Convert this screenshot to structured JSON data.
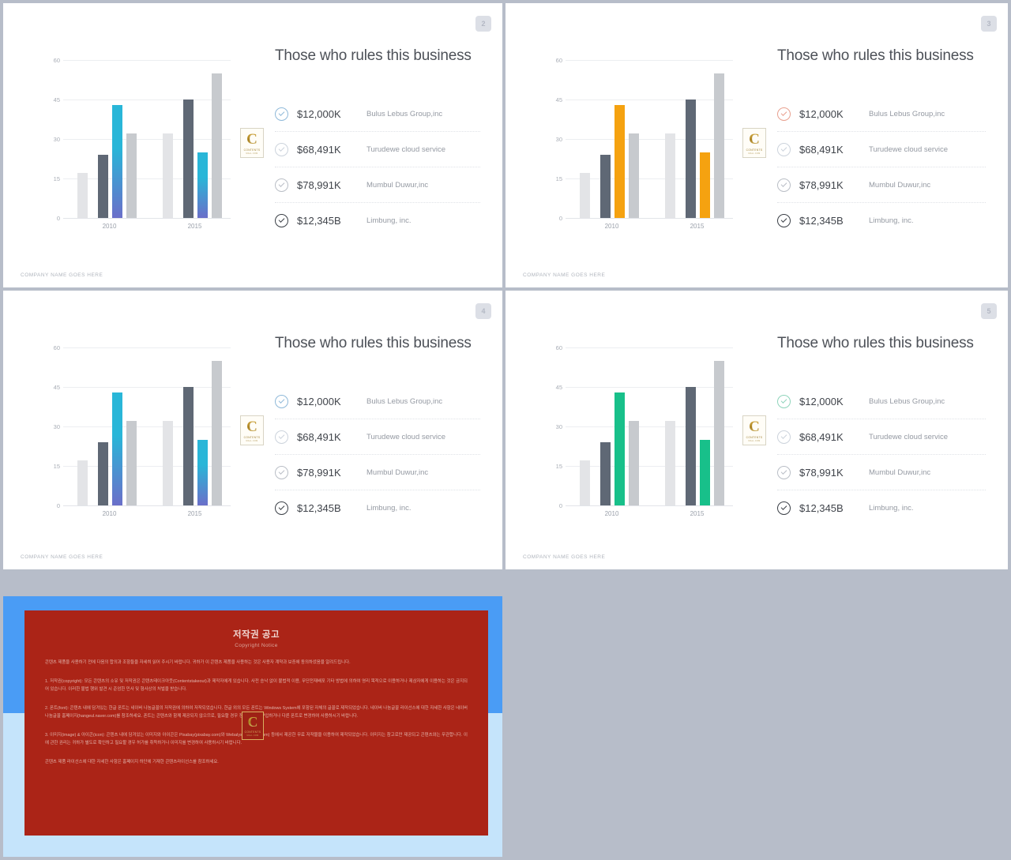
{
  "page": {
    "background_color": "#b7bdc9"
  },
  "slides": [
    {
      "number": "2",
      "title": "Those who rules this business",
      "footer": "COMPANY NAME GOES HERE",
      "accent_color": "#29b6d8",
      "accent_color_2": "#6b6fc9",
      "accent_style": "gradient",
      "check_colors": [
        "#8fb9d9",
        "#ccd3dc",
        "#b9bec6",
        "#3a3f46"
      ],
      "legend": [
        {
          "value": "$12,000K",
          "name": "Bulus Lebus Group,inc"
        },
        {
          "value": "$68,491K",
          "name": "Turudewe cloud service"
        },
        {
          "value": "$78,991K",
          "name": "Mumbul Duwur,inc"
        },
        {
          "value": "$12,345B",
          "name": "Limbung, inc."
        }
      ],
      "logo": {
        "letter": "C",
        "line1": "CONTENTS",
        "line2": "MALL.COM"
      }
    },
    {
      "number": "3",
      "title": "Those who rules this business",
      "footer": "COMPANY NAME GOES HERE",
      "accent_color": "#f5a210",
      "accent_color_2": "#f5a210",
      "accent_style": "solid",
      "check_colors": [
        "#e8a08f",
        "#ccd3dc",
        "#b9bec6",
        "#3a3f46"
      ],
      "legend": [
        {
          "value": "$12,000K",
          "name": "Bulus Lebus Group,inc"
        },
        {
          "value": "$68,491K",
          "name": "Turudewe cloud service"
        },
        {
          "value": "$78,991K",
          "name": "Mumbul Duwur,inc"
        },
        {
          "value": "$12,345B",
          "name": "Limbung, inc."
        }
      ],
      "logo": {
        "letter": "C",
        "line1": "CONTENTS",
        "line2": "MALL.COM"
      }
    },
    {
      "number": "4",
      "title": "Those who rules this business",
      "footer": "COMPANY NAME GOES HERE",
      "accent_color": "#29b6d8",
      "accent_color_2": "#6b6fc9",
      "accent_style": "gradient",
      "check_colors": [
        "#8fb9d9",
        "#ccd3dc",
        "#b9bec6",
        "#3a3f46"
      ],
      "legend": [
        {
          "value": "$12,000K",
          "name": "Bulus Lebus Group,inc"
        },
        {
          "value": "$68,491K",
          "name": "Turudewe cloud service"
        },
        {
          "value": "$78,991K",
          "name": "Mumbul Duwur,inc"
        },
        {
          "value": "$12,345B",
          "name": "Limbung, inc."
        }
      ],
      "logo": {
        "letter": "C",
        "line1": "CONTENTS",
        "line2": "MALL.COM"
      }
    },
    {
      "number": "5",
      "title": "Those who rules this business",
      "footer": "COMPANY NAME GOES HERE",
      "accent_color": "#18c08a",
      "accent_color_2": "#18c08a",
      "accent_style": "solid",
      "check_colors": [
        "#8fd4bb",
        "#ccd3dc",
        "#b9bec6",
        "#3a3f46"
      ],
      "legend": [
        {
          "value": "$12,000K",
          "name": "Bulus Lebus Group,inc"
        },
        {
          "value": "$68,491K",
          "name": "Turudewe cloud service"
        },
        {
          "value": "$78,991K",
          "name": "Mumbul Duwur,inc"
        },
        {
          "value": "$12,345B",
          "name": "Limbung, inc."
        }
      ],
      "logo": {
        "letter": "C",
        "line1": "CONTENTS",
        "line2": "MALL.COM"
      }
    }
  ],
  "chart_data": {
    "type": "bar",
    "title": "Those who rules this business",
    "categories": [
      "2010",
      "2015"
    ],
    "xlabel": "",
    "ylabel": "",
    "ylim": [
      0,
      60
    ],
    "yticks": [
      0,
      15,
      30,
      45,
      60
    ],
    "grid": true,
    "legend_position": "right",
    "series": [
      {
        "name": "Bulus Lebus Group,inc",
        "values": [
          17,
          32
        ],
        "color": "#e3e4e7",
        "role": "light"
      },
      {
        "name": "Turudewe cloud service",
        "values": [
          24,
          45
        ],
        "color": "#5f6875",
        "role": "dark"
      },
      {
        "name": "Mumbul Duwur,inc",
        "values": [
          43,
          25
        ],
        "color": "accent",
        "role": "highlight"
      },
      {
        "name": "Limbung, inc.",
        "values": [
          32,
          55
        ],
        "color": "#c7cace",
        "role": "mid"
      }
    ]
  },
  "copyright_slide": {
    "heading_ko": "저작권 공고",
    "heading_en": "Copyright Notice",
    "paragraphs": [
      "콘텐츠 제품을 사용하기 전에 다음의 합의과 조항들을 자세히 읽어 주시기 바랍니다. 귀하가 이 콘텐츠 제품을 사용하는 것은 사용자 계약과 보증에 동의하셨음을 알려드립니다.",
      "1. 저작권(copyright): 모든 콘텐츠의 소유 및 저작권은 콘텐츠테이크아웃(Contentstakeout)과 제작자에게 있습니다. 사전 승낙 없이 불법적 이용, 무단전재배포 기타 방법에 의하여 영리 목적으로 이용하거나 제삼자에게 이용하는 것은 금지되어 있습니다. 이러한 불법 행위 발견 시 준엄한 민사 및 형사상의 처벌을 받습니다.",
      "2. 폰트(font): 콘텐츠 내에 담겨있는 한글 폰트는 네이버 나눔글꼴의 저작권에 의하여 저작되었습니다. 한글 외의 모든 폰트는 Windows System에 포함된 자체의 글꼴로 제작되었습니다. 네이버 나눔글꼴 라이선스에 대한 자세한 사항은 네이버 나눔글꼴 홈페이지(hangeul.naver.com)를 참조하세요. 폰트는 콘텐츠와 함께 제공되지 않으므로, 필요할 경우 정품 폰트를 구입하거나 다른 폰트로 변경하여 사용하시기 바랍니다.",
      "3. 이미지(image) & 아이콘(icon): 콘텐츠 내에 담겨있는 이미지와 아이콘은 Pixabay(pixabay.com)와 Webalys(webalys.com) 등에서 제공한 무료 저작물을 이용하여 제작되었습니다. 이미지는 참고로만 제공되고 콘텐츠와는 무관합니다. 이에 관한 권리는 귀하가 별도로 확인하고 필요할 경우 허가를 취득하거나 이미지를 변경하여 사용하시기 바랍니다.",
      "콘텐츠 제품 라이선스에 대한 자세한 사항은 홈페이지 하단에 기재한 콘텐츠라이선스를 참조하세요."
    ],
    "logo": {
      "letter": "C",
      "line1": "CONTENTS",
      "line2": "MALL.COM"
    },
    "panel_color": "#ab2417",
    "band_color": "#4a9cf5",
    "body_color": "#c5e4fb"
  }
}
